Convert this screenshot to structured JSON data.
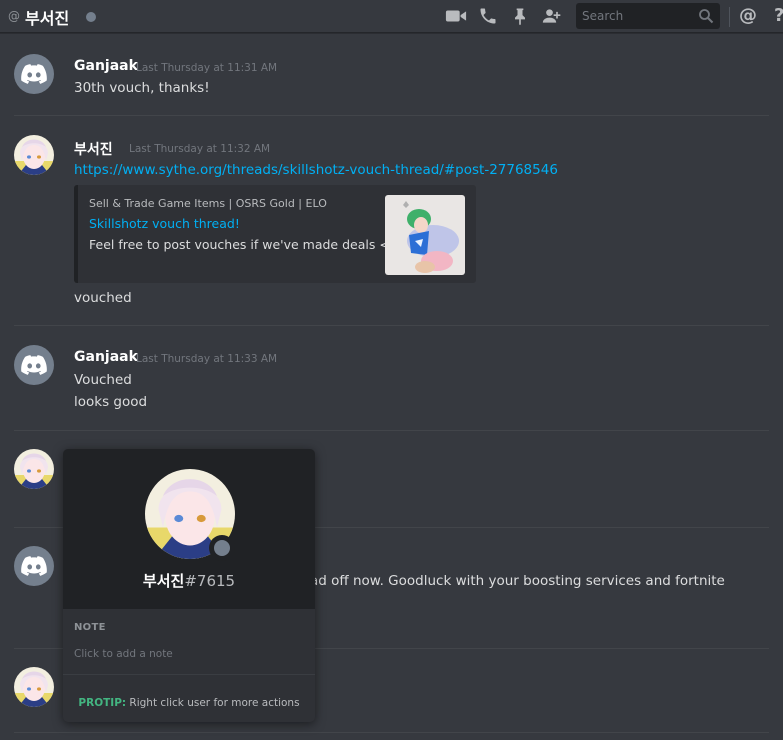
{
  "header": {
    "at_symbol": "@",
    "channel_name": "부서진",
    "status": "offline",
    "icons": [
      "video-call-icon",
      "voice-call-icon",
      "pin-icon",
      "add-friend-icon",
      "search-icon",
      "mentions-icon",
      "help-icon"
    ],
    "search_placeholder": "Search",
    "mentions_label": "@",
    "help_label": "?"
  },
  "messages": [
    {
      "author": "Ganjaak",
      "timestamp": "Last Thursday at 11:31 AM",
      "lines": [
        "30th vouch, thanks!"
      ],
      "avatar": "discord-default"
    },
    {
      "author": "부서진",
      "timestamp": "Last Thursday at 11:32 AM",
      "link": "https://www.sythe.org/threads/skillshotz-vouch-thread/#post-27768546",
      "embed": {
        "provider": "Sell & Trade Game Items | OSRS Gold | ELO",
        "title": "Skillshotz vouch thread!",
        "description": "Feel free to post vouches if we've made deals <3"
      },
      "lines": [
        "vouched"
      ],
      "avatar": "anime"
    },
    {
      "author": "Ganjaak",
      "timestamp": "Last Thursday at 11:33 AM",
      "lines": [
        "Vouched",
        "looks good"
      ],
      "avatar": "discord-default"
    },
    {
      "avatar": "anime"
    },
    {
      "avatar": "discord-default",
      "lines": [
        "ad off now. Goodluck with your boosting services and fortnite"
      ]
    },
    {
      "avatar": "anime"
    }
  ],
  "popout": {
    "username": "부서진",
    "discriminator": "#7615",
    "note_header": "NOTE",
    "note_placeholder": "Click to add a note",
    "protip_label": "PROTIP:",
    "protip_text": " Right click user for more actions"
  },
  "colors": {
    "background": "#36393f",
    "link": "#00b0f4",
    "protip": "#43b581",
    "offline": "#747f8d"
  }
}
